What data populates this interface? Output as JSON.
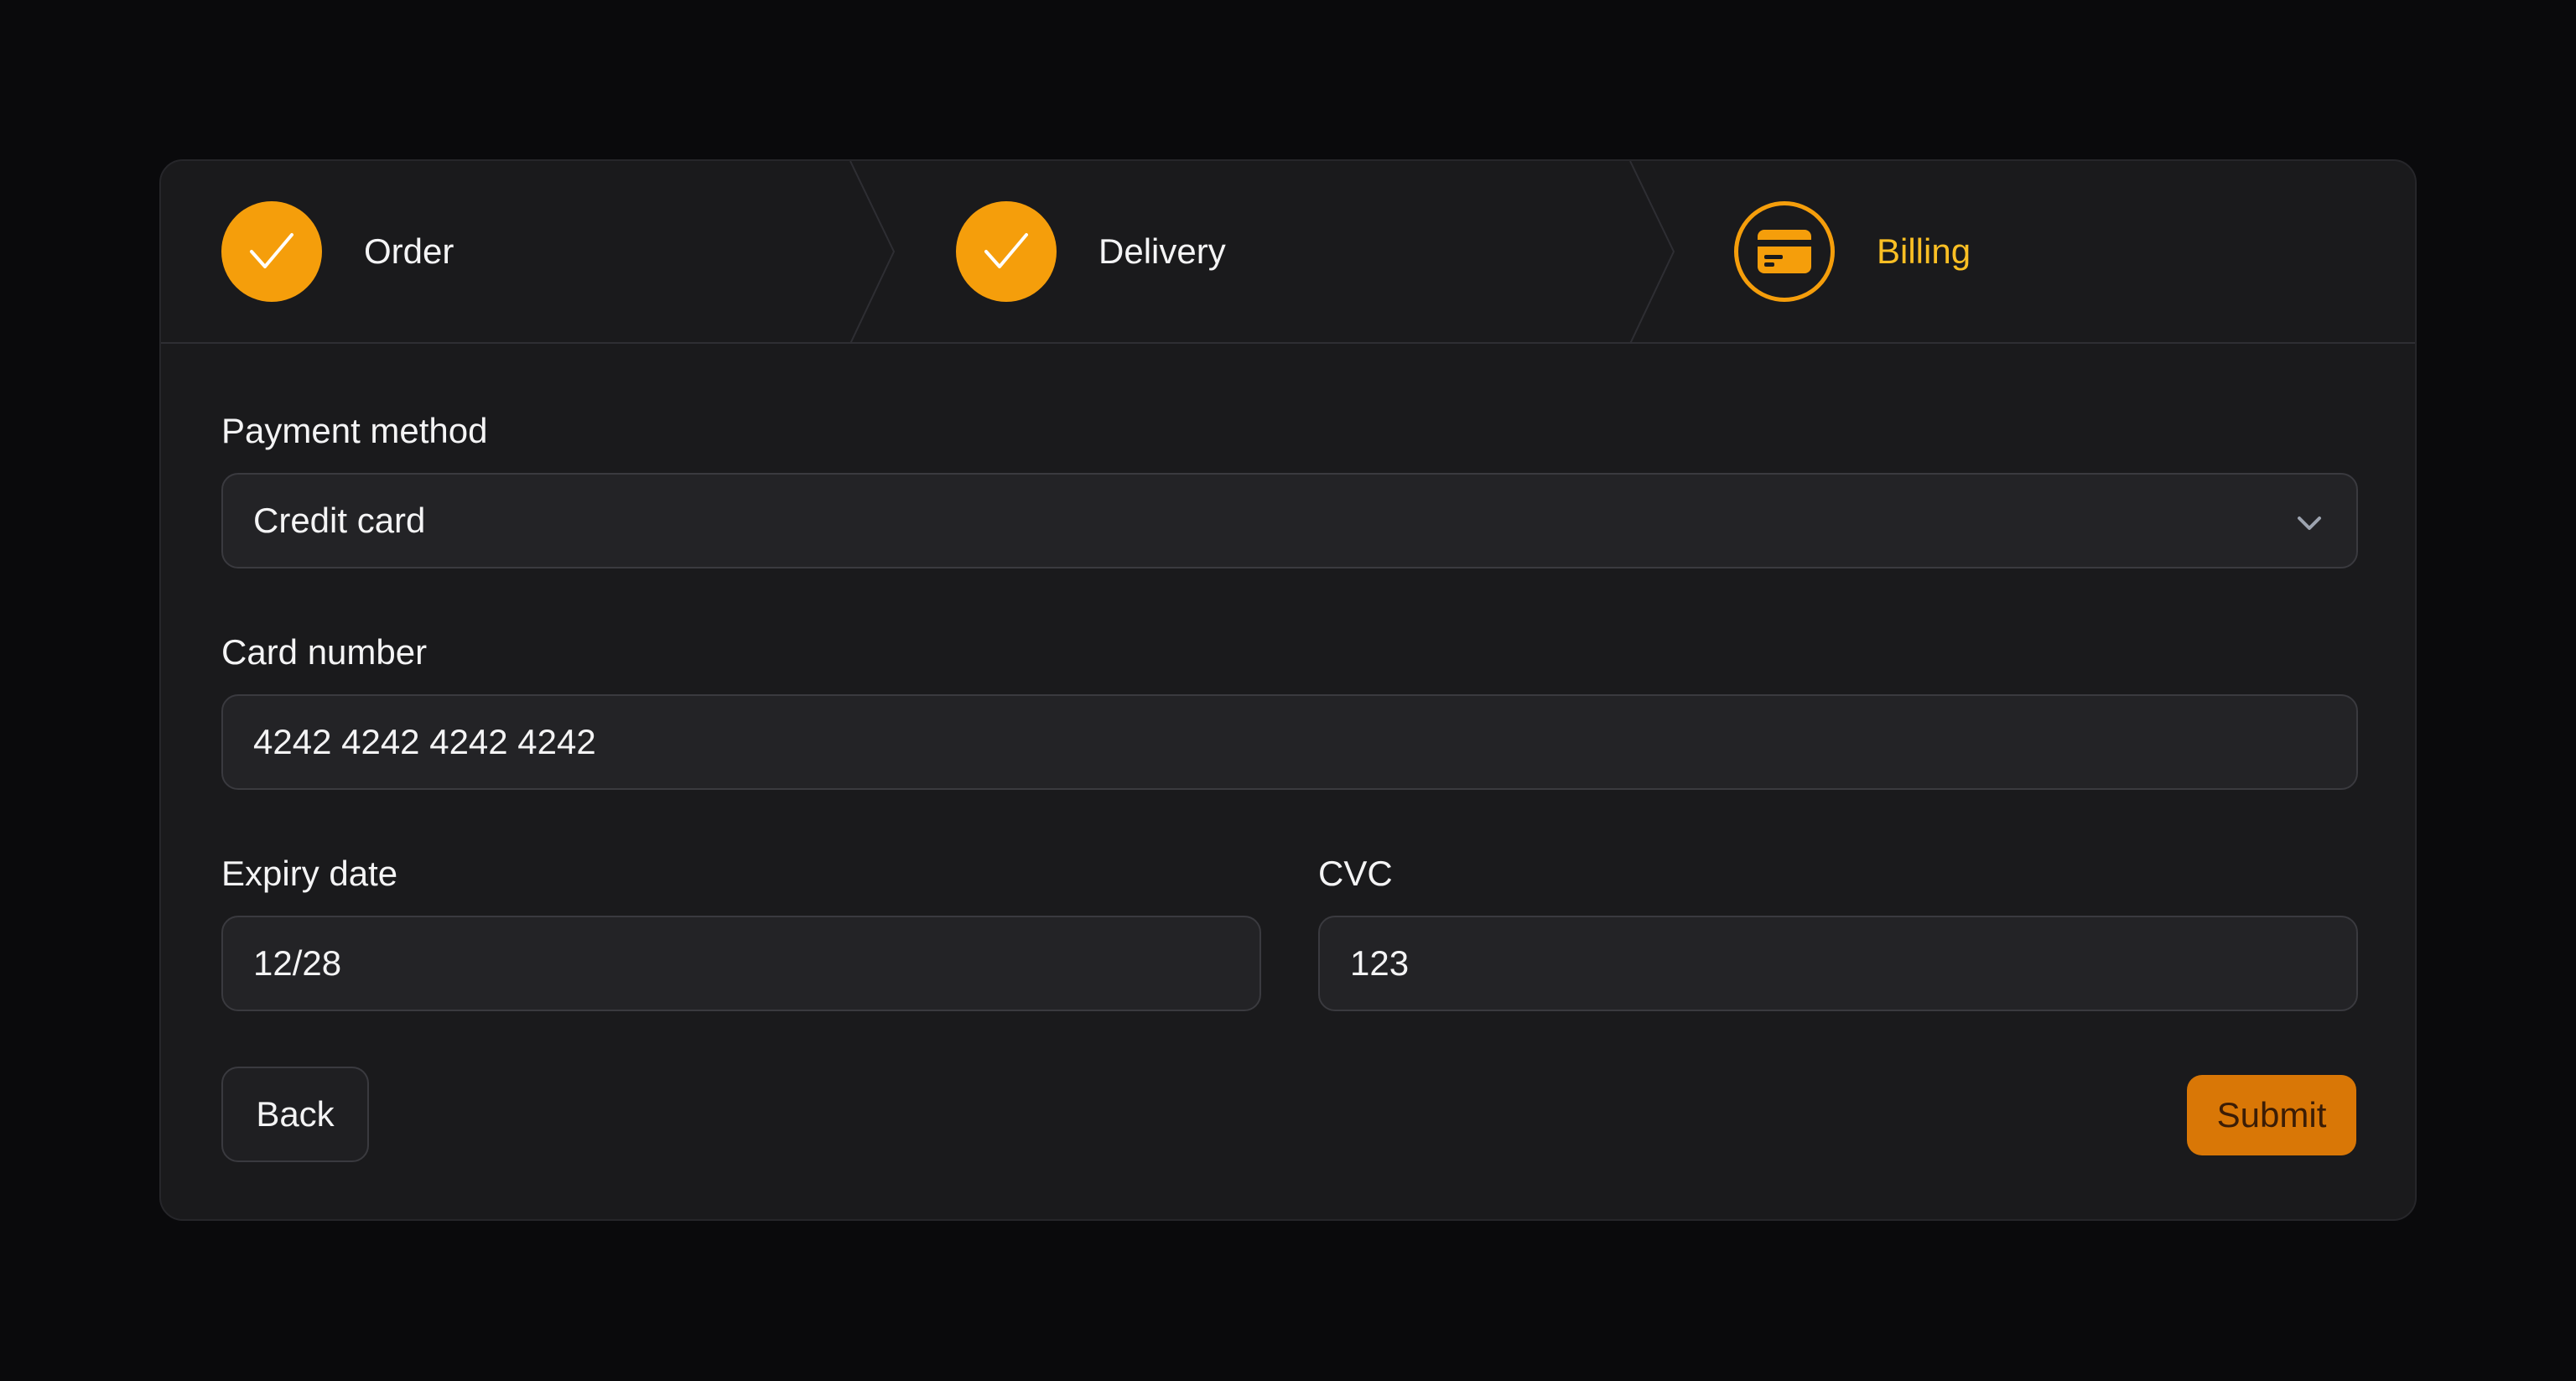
{
  "stepper": {
    "steps": [
      {
        "label": "Order",
        "state": "complete",
        "icon": "check-icon"
      },
      {
        "label": "Delivery",
        "state": "complete",
        "icon": "check-icon"
      },
      {
        "label": "Billing",
        "state": "current",
        "icon": "credit-card-icon"
      }
    ]
  },
  "form": {
    "payment_method": {
      "label": "Payment method",
      "value": "Credit card",
      "icon": "chevron-down-icon"
    },
    "card_number": {
      "label": "Card number",
      "value": "4242 4242 4242 4242"
    },
    "expiry_date": {
      "label": "Expiry date",
      "value": "12/28"
    },
    "cvc": {
      "label": "CVC",
      "value": "123"
    }
  },
  "actions": {
    "back_label": "Back",
    "submit_label": "Submit"
  },
  "colors": {
    "accent": "#f59e0b",
    "accent_text": "#fbbf24",
    "submit_bg": "#d97706",
    "background": "#0a0a0c",
    "card_bg": "#1a1a1c"
  }
}
